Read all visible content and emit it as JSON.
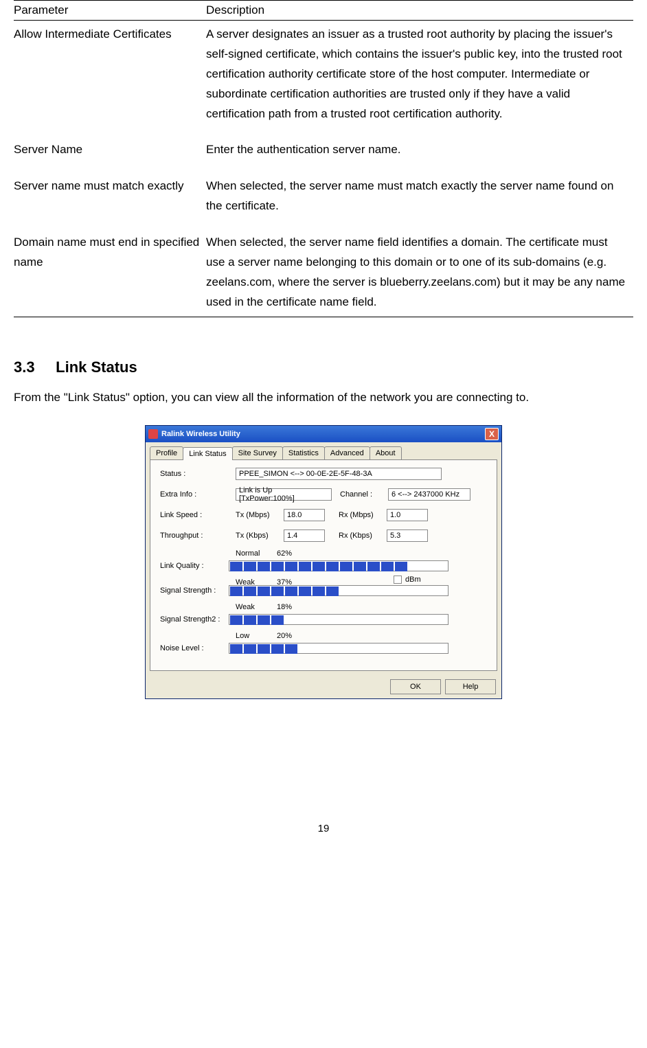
{
  "table": {
    "headers": {
      "param": "Parameter",
      "desc": "Description"
    },
    "rows": [
      {
        "param": "Allow Intermediate Certificates",
        "desc": "A server designates an issuer as a trusted root authority by placing the issuer's self-signed certificate, which contains the issuer's public key, into the trusted root certification authority certificate store of the host computer. Intermediate or subordinate certification authorities are trusted only if they have a valid certification path from a trusted root certification authority."
      },
      {
        "param": "Server Name",
        "desc": "Enter the authentication server name."
      },
      {
        "param": "Server name must match exactly",
        "desc": "When selected, the server name must match exactly the server name found on the certificate."
      },
      {
        "param": "Domain name must end in specified name",
        "desc": "When selected, the server name field identifies a domain. The certificate must use a server name belonging to this domain or to one of its sub-domains (e.g. zeelans.com, where the server is blueberry.zeelans.com) but it may be any name used in the certificate name field."
      }
    ]
  },
  "section": {
    "number": "3.3",
    "title": "Link Status",
    "intro": "From the \"Link Status\" option, you can view all the information of the network you are connecting to."
  },
  "dialog": {
    "title": "Ralink Wireless Utility",
    "close": "X",
    "tabs": [
      "Profile",
      "Link Status",
      "Site Survey",
      "Statistics",
      "Advanced",
      "About"
    ],
    "activeTab": 1,
    "labels": {
      "status": "Status :",
      "extraInfo": "Extra Info :",
      "channelLabel": "Channel :",
      "linkSpeed": "Link Speed :",
      "throughput": "Throughput :",
      "txMbps": "Tx (Mbps)",
      "rxMbps": "Rx (Mbps)",
      "txKbps": "Tx (Kbps)",
      "rxKbps": "Rx (Kbps)",
      "linkQuality": "Link Quality :",
      "signalStrength": "Signal Strength :",
      "signalStrength2": "Signal Strength2 :",
      "noiseLevel": "Noise Level :",
      "dbm": "dBm",
      "ok": "OK",
      "help": "Help"
    },
    "values": {
      "status": "PPEE_SIMON <--> 00-0E-2E-5F-48-3A",
      "extraInfo": "Link is Up [TxPower:100%]",
      "channel": "6 <--> 2437000 KHz",
      "txMbps": "18.0",
      "rxMbps": "1.0",
      "txKbps": "1.4",
      "rxKbps": "5.3",
      "linkQuality": {
        "word": "Normal",
        "pct": "62%",
        "blocks": 13
      },
      "signalStrength": {
        "word": "Weak",
        "pct": "37%",
        "blocks": 8
      },
      "signalStrength2": {
        "word": "Weak",
        "pct": "18%",
        "blocks": 4
      },
      "noiseLevel": {
        "word": "Low",
        "pct": "20%",
        "blocks": 5
      }
    }
  },
  "pageNumber": "19"
}
